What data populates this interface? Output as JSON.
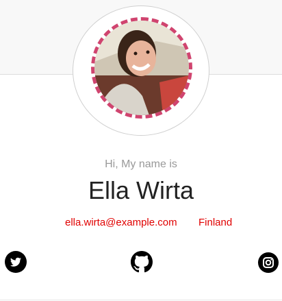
{
  "profile": {
    "greeting": "Hi, My name is",
    "name": "Ella Wirta",
    "email": "ella.wirta@example.com",
    "country": "Finland",
    "avatar_alt": "profile photo"
  },
  "social": {
    "icons": [
      "twitter-icon",
      "github-icon",
      "instagram-icon"
    ]
  },
  "colors": {
    "accent": "#e00000",
    "avatar_border": "#d0446f",
    "banner": "#f8f8f8",
    "name_text": "#222222",
    "muted_text": "#999999"
  }
}
